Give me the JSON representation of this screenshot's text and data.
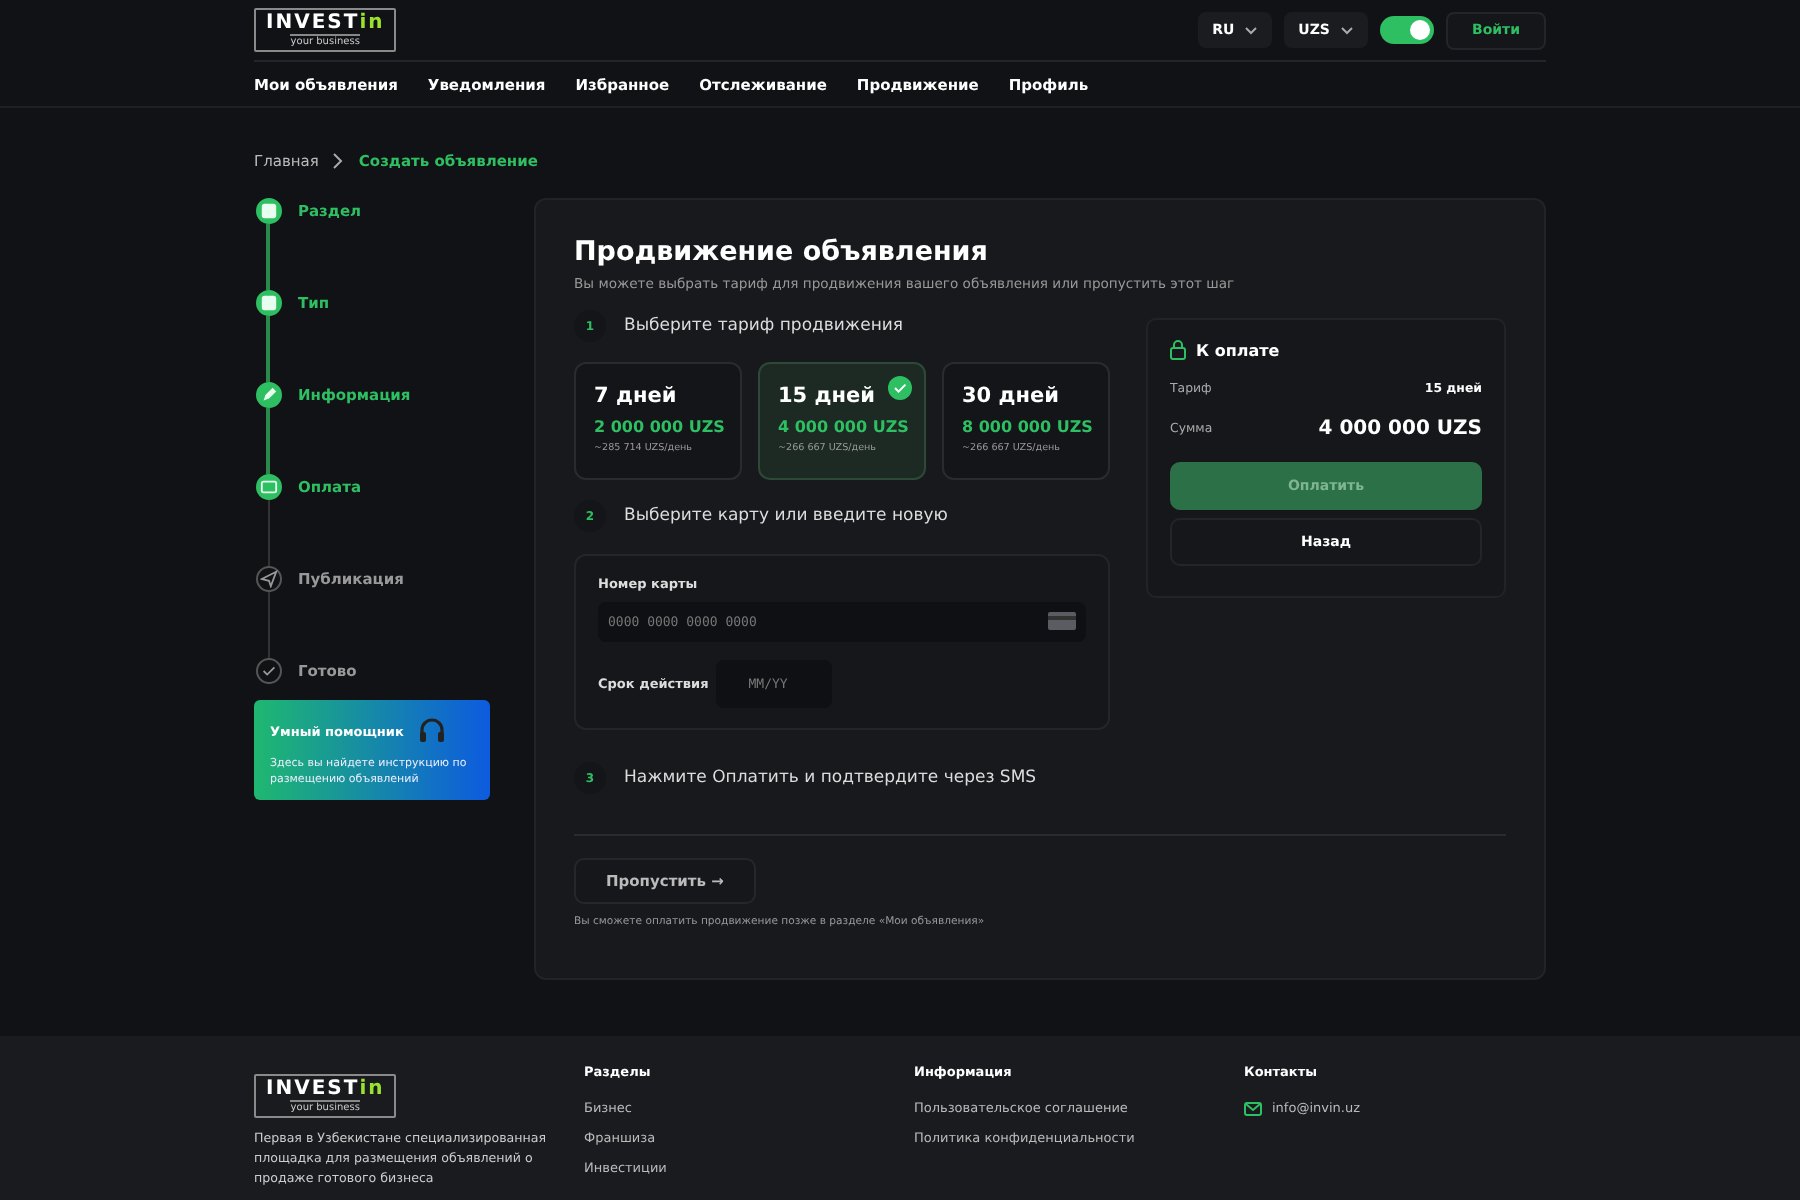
{
  "header": {
    "logo": {
      "name": "INVEST",
      "accent": "in",
      "tagline": "your business"
    },
    "language": "RU",
    "currency": "UZS",
    "theme_toggle": {
      "on": true
    },
    "login": "Войти"
  },
  "nav": [
    "Мои объявления",
    "Уведомления",
    "Избранное",
    "Отслеживание",
    "Продвижение",
    "Профиль"
  ],
  "breadcrumbs": [
    "Главная",
    "Создать объявление"
  ],
  "steps": [
    {
      "label": "Раздел",
      "done": true
    },
    {
      "label": "Тип",
      "done": true
    },
    {
      "label": "Информация",
      "done": true
    },
    {
      "label": "Оплата",
      "done": true
    },
    {
      "label": "Публикация",
      "done": false
    },
    {
      "label": "Готово",
      "done": false
    }
  ],
  "helper": {
    "title": "Умный помощник",
    "text": "Здесь вы найдете инструкцию по размещению объявлений"
  },
  "page": {
    "title": "Продвижение объявления",
    "subtitle": "Вы можете выбрать тариф для продвижения вашего объявления или пропустить этот шаг",
    "step1": {
      "number": "1",
      "label": "Выберите тариф продвижения"
    },
    "tariffs": [
      {
        "days": "7 дней",
        "price": "2 000 000 UZS",
        "per_day": "~285 714 UZS/день",
        "selected": false
      },
      {
        "days": "15 дней",
        "price": "4 000 000 UZS",
        "per_day": "~266 667 UZS/день",
        "selected": true
      },
      {
        "days": "30 дней",
        "price": "8 000 000 UZS",
        "per_day": "~266 667 UZS/день",
        "selected": false
      }
    ],
    "step2": {
      "number": "2",
      "label": "Выберите карту или введите новую"
    },
    "card_form": {
      "number_label": "Номер карты",
      "number_placeholder": "0000 0000 0000 0000",
      "expiry_label": "Срок действия",
      "expiry_placeholder": "MM/YY"
    },
    "step3": {
      "number": "3",
      "label": "Нажмите Оплатить и подтвердите через SMS"
    },
    "skip": "Пропустить →",
    "note": "Вы сможете оплатить продвижение позже в разделе «Мои объявления»"
  },
  "summary": {
    "title": "К оплате",
    "tariff_label": "Тариф",
    "tariff_value": "15 дней",
    "sum_label": "Сумма",
    "sum_value": "4 000 000 UZS",
    "pay": {
      "label": "Оплатить",
      "disabled": true
    },
    "back": "Назад"
  },
  "footer": {
    "logo": {
      "name": "INVEST",
      "accent": "in",
      "tagline": "your business"
    },
    "description": "Первая в Узбекистане специализированная площадка для размещения объявлений о продаже готового бизнеса",
    "columns": [
      {
        "title": "Разделы",
        "links": [
          "Бизнес",
          "Франшиза",
          "Инвестиции"
        ]
      },
      {
        "title": "Информация",
        "links": [
          "Пользовательское соглашение",
          "Политика конфиденциальности"
        ]
      }
    ],
    "contacts": {
      "title": "Контакты",
      "email": "info@invin.uz"
    }
  }
}
